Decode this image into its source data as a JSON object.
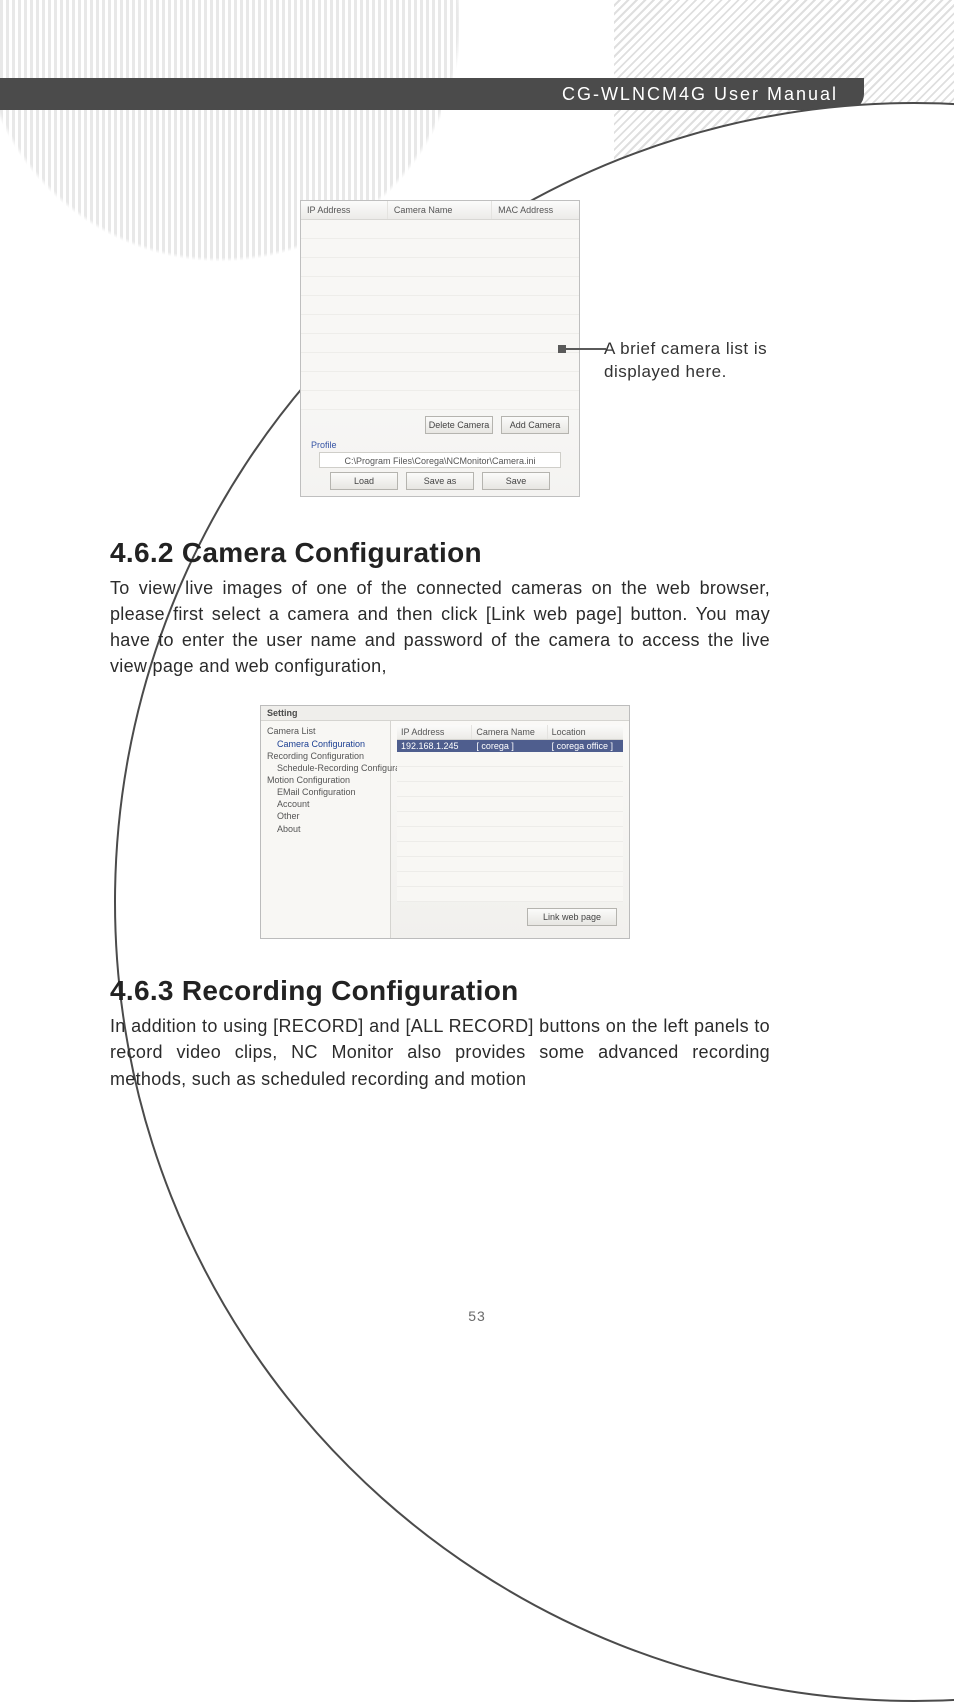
{
  "header": {
    "title": "CG-WLNCM4G User Manual"
  },
  "callout": {
    "line1": "A brief camera list is",
    "line2": "displayed here."
  },
  "panel_a": {
    "cols": [
      "IP Address",
      "Camera Name",
      "MAC Address"
    ],
    "delete_btn": "Delete Camera",
    "add_btn": "Add Camera",
    "profile_label": "Profile",
    "profile_path": "C:\\Program Files\\Corega\\NCMonitor\\Camera.ini",
    "load_btn": "Load",
    "saveas_btn": "Save as",
    "save_btn": "Save"
  },
  "section1": {
    "heading": "4.6.2 Camera Configuration",
    "body": "To view live images of one of the connected cameras on the web browser, please first select a camera and then click [Link web page] button. You may have to enter the user name and password of the camera to access the live view page and web configuration,"
  },
  "panel_b": {
    "title": "Setting",
    "tree": {
      "camera_list": "Camera List",
      "camera_conf": "Camera Configuration",
      "recording_conf": "Recording Configuration",
      "schedule_rec": "Schedule-Recording Configuration",
      "motion_conf": "Motion Configuration",
      "email_conf": "EMail Configuration",
      "account": "Account",
      "other": "Other",
      "about": "About"
    },
    "cols": [
      "IP Address",
      "Camera Name",
      "Location"
    ],
    "row": {
      "ip": "192.168.1.245",
      "name": "[ corega ]",
      "loc": "[ corega office ]"
    },
    "link_btn": "Link web page"
  },
  "section2": {
    "heading": "4.6.3 Recording Configuration",
    "body": "In addition to using [RECORD] and [ALL RECORD] buttons on the left panels to record video clips, NC Monitor also provides some advanced recording methods, such as scheduled recording and motion"
  },
  "page_number": "53"
}
